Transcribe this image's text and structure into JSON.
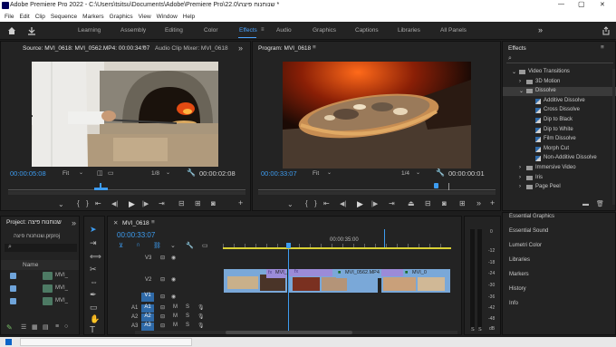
{
  "title_bar": {
    "title": "Adobe Premiere Pro 2022 - C:\\Users\\tsitsu\\Documents\\Adobe\\Premiere Pro\\22.0\\שנוחנוח פיצה *",
    "minimize": "—",
    "maximize": "▢",
    "close": "✕"
  },
  "menu": [
    "File",
    "Edit",
    "Clip",
    "Sequence",
    "Markers",
    "Graphics",
    "View",
    "Window",
    "Help"
  ],
  "workspaces": [
    "Learning",
    "Assembly",
    "Editing",
    "Color",
    "Effects",
    "Audio",
    "Graphics",
    "Captions",
    "Libraries",
    "All Panels"
  ],
  "active_workspace": "Effects",
  "source": {
    "tab": "Source: MVI_0618: MVI_0562.MP4: 00:00:34:07",
    "tab2": "Audio Clip Mixer: MVI_0618",
    "timecode": "00:00:05:08",
    "fit": "Fit",
    "ratio": "1/8",
    "duration": "00:00:02:08"
  },
  "program": {
    "tab": "Program: MVI_0618",
    "timecode": "00:00:33:07",
    "fit": "Fit",
    "ratio": "1/4",
    "duration": "00:00:00:01"
  },
  "project": {
    "tab": "Project: שנוחנוח פיצה",
    "file": "שנוחנוח פיצה.prproj",
    "column": "Name",
    "items": [
      "MVI_",
      "MVI_",
      "MVI_"
    ]
  },
  "timeline": {
    "tab": "MVI_0618",
    "timecode": "00:00:33:07",
    "ruler_mark": "00:00:35:00",
    "video_tracks": [
      "V3",
      "V2",
      "V1"
    ],
    "audio_tracks": [
      "A1",
      "A2",
      "A3"
    ],
    "clips": [
      "MVI_",
      "MVI_0562.MP4",
      "MVI_0"
    ],
    "fx_label": "fx"
  },
  "meter": {
    "labels": [
      "0",
      "-12",
      "-18",
      "-24",
      "-30",
      "-36",
      "-42",
      "-48",
      "dB"
    ],
    "solo": "S",
    "solo2": "S"
  },
  "effects": {
    "tab": "Effects",
    "tree": [
      {
        "label": "Video Transitions",
        "level": 0,
        "open": true
      },
      {
        "label": "3D Motion",
        "level": 1
      },
      {
        "label": "Dissolve",
        "level": 1,
        "open": true,
        "selected": true
      },
      {
        "label": "Additive Dissolve",
        "level": 2
      },
      {
        "label": "Cross Dissolve",
        "level": 2
      },
      {
        "label": "Dip to Black",
        "level": 2
      },
      {
        "label": "Dip to White",
        "level": 2
      },
      {
        "label": "Film Dissolve",
        "level": 2
      },
      {
        "label": "Morph Cut",
        "level": 2
      },
      {
        "label": "Non-Additive Dissolve",
        "level": 2
      },
      {
        "label": "Immersive Video",
        "level": 1
      },
      {
        "label": "Iris",
        "level": 1
      },
      {
        "label": "Page Peel",
        "level": 1
      }
    ]
  },
  "panels": [
    "Essential Graphics",
    "Essential Sound",
    "Lumetri Color",
    "Libraries",
    "Markers",
    "History",
    "Info"
  ],
  "colors": {
    "accent": "#3d9cf0",
    "timecode": "#3d9cf0",
    "clip_purple": "#9b8bd8",
    "clip_blue": "#7aa8d8",
    "playhead": "#3d9cf0"
  }
}
